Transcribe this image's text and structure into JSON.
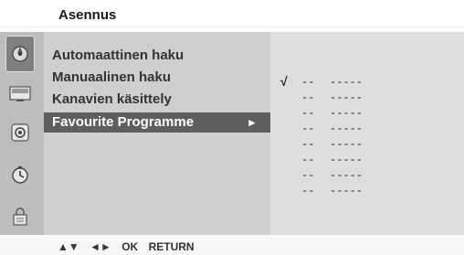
{
  "header": {
    "title": "Asennus"
  },
  "sidebar": {
    "icons": [
      {
        "name": "setup-icon",
        "active": true
      },
      {
        "name": "picture-icon",
        "active": false
      },
      {
        "name": "sound-icon",
        "active": false
      },
      {
        "name": "time-icon",
        "active": false
      },
      {
        "name": "special-icon",
        "active": false
      }
    ]
  },
  "menu": {
    "items": [
      {
        "label": "Automaattinen haku"
      },
      {
        "label": "Manuaalinen haku"
      },
      {
        "label": "Kanavien käsittely"
      },
      {
        "label": "Favourite Programme",
        "selected": true,
        "arrow": "►"
      }
    ]
  },
  "favourites": {
    "rows": [
      {
        "check": "√",
        "number": "--",
        "name": "-----"
      },
      {
        "check": "",
        "number": "--",
        "name": "-----"
      },
      {
        "check": "",
        "number": "--",
        "name": "-----"
      },
      {
        "check": "",
        "number": "--",
        "name": "-----"
      },
      {
        "check": "",
        "number": "--",
        "name": "-----"
      },
      {
        "check": "",
        "number": "--",
        "name": "-----"
      },
      {
        "check": "",
        "number": "--",
        "name": "-----"
      },
      {
        "check": "",
        "number": "--",
        "name": "-----"
      }
    ]
  },
  "footer": {
    "keys": [
      "▲▼",
      "◄►",
      "OK",
      "RETURN"
    ]
  }
}
